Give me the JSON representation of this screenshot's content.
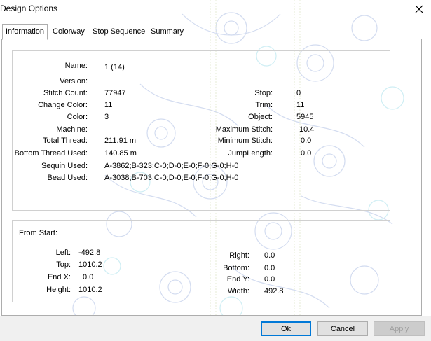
{
  "window": {
    "title": "Design Options",
    "close_glyph": "✕"
  },
  "tabs": [
    {
      "label": "Information",
      "active": true
    },
    {
      "label": "Colorway",
      "active": false
    },
    {
      "label": "Stop Sequence",
      "active": false
    },
    {
      "label": "Summary",
      "active": false
    }
  ],
  "info": {
    "name_label": "Name:",
    "name_value": "1 (14)",
    "version_label": "Version:",
    "version_value": "",
    "stitch_count_label": "Stitch Count:",
    "stitch_count_value": "77947",
    "change_color_label": "Change Color:",
    "change_color_value": "11",
    "color_label": "Color:",
    "color_value": "3",
    "machine_label": "Machine:",
    "machine_value": "",
    "total_thread_label": "Total Thread:",
    "total_thread_value": "211.91 m",
    "bottom_thread_label": "Bottom Thread Used:",
    "bottom_thread_value": "140.85 m",
    "sequin_label": "Sequin Used:",
    "sequin_value": "A-3862;B-323;C-0;D-0;E-0;F-0;G-0;H-0",
    "bead_label": "Bead Used:",
    "bead_value": "A-3038;B-703;C-0;D-0;E-0;F-0;G-0;H-0",
    "stop_label": "Stop:",
    "stop_value": "0",
    "trim_label": "Trim:",
    "trim_value": "11",
    "object_label": "Object:",
    "object_value": "5945",
    "max_stitch_label": "Maximum Stitch:",
    "max_stitch_value": "10.4",
    "min_stitch_label": "Minimum Stitch:",
    "min_stitch_value": "0.0",
    "jump_length_label": "JumpLength:",
    "jump_length_value": "0.0"
  },
  "from_start": {
    "heading": "From Start:",
    "left_label": "Left:",
    "left_value": "-492.8",
    "top_label": "Top:",
    "top_value": "1010.2",
    "endx_label": "End X:",
    "endx_value": "0.0",
    "height_label": "Height:",
    "height_value": "1010.2",
    "right_label": "Right:",
    "right_value": "0.0",
    "bottom_label": "Bottom:",
    "bottom_value": "0.0",
    "endy_label": "End Y:",
    "endy_value": "0.0",
    "width_label": "Width:",
    "width_value": "492.8"
  },
  "buttons": {
    "ok": "Ok",
    "cancel": "Cancel",
    "apply": "Apply"
  },
  "colors": {
    "ok_border": "#0078d7",
    "pattern": "#c8d4ee",
    "pattern_accent": "#c8ecf2"
  }
}
